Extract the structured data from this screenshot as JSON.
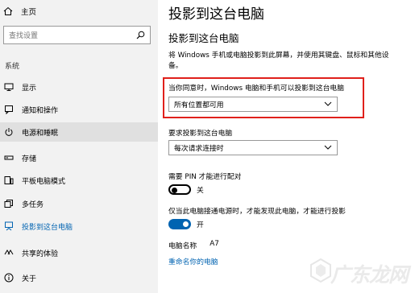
{
  "sidebar": {
    "home_label": "主页",
    "search_placeholder": "查找设置",
    "section_label": "系统",
    "items": [
      {
        "label": "显示",
        "icon": "monitor-icon"
      },
      {
        "label": "通知和操作",
        "icon": "notification-icon"
      },
      {
        "label": "电源和睡眠",
        "icon": "power-icon"
      },
      {
        "label": "存储",
        "icon": "storage-icon"
      },
      {
        "label": "平板电脑模式",
        "icon": "tablet-icon"
      },
      {
        "label": "多任务",
        "icon": "multitask-icon"
      },
      {
        "label": "投影到这台电脑",
        "icon": "project-icon"
      },
      {
        "label": "共享的体验",
        "icon": "shared-icon"
      },
      {
        "label": "关于",
        "icon": "info-icon"
      }
    ],
    "active_index": 6,
    "hover_index": 2
  },
  "main": {
    "page_title": "投影到这台电脑",
    "section_title": "投影到这台电脑",
    "description": "将 Windows 手机或电脑投影到此屏幕，并使用其键盘、鼠标和其他设备。",
    "permission_label": "当你同意时，Windows 电脑和手机可以投影到这台电脑",
    "permission_value": "所有位置都可用",
    "ask_label": "要求投影到这台电脑",
    "ask_value": "每次请求连接时",
    "pin_label": "需要 PIN 才能进行配对",
    "pin_state": "关",
    "power_label": "仅当此电脑接通电源时，才能发现此电脑，才能进行投影",
    "power_state": "开",
    "pc_name_label": "电脑名称",
    "pc_name_value": "A7",
    "rename_link": "重命名你的电脑"
  },
  "watermark": "广东龙网",
  "colors": {
    "accent": "#0063b1",
    "highlight_border": "#e0201b",
    "sidebar_bg": "#f2f2f2"
  }
}
